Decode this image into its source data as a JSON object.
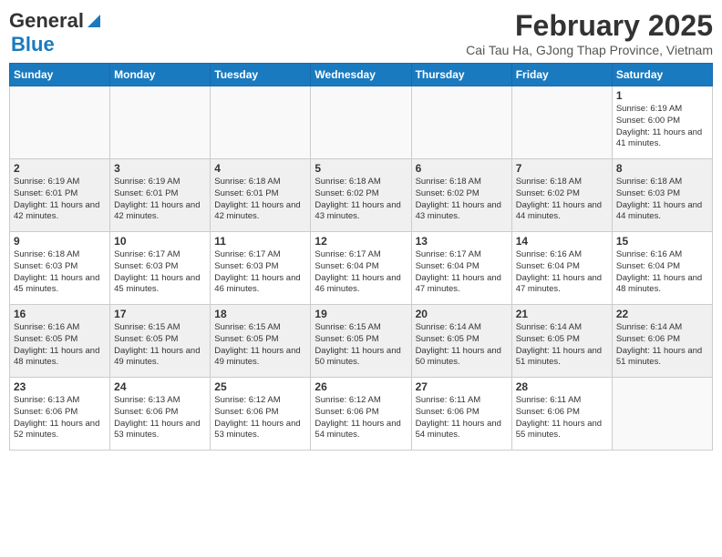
{
  "header": {
    "logo_general": "General",
    "logo_blue": "Blue",
    "month": "February 2025",
    "location": "Cai Tau Ha, GJong Thap Province, Vietnam"
  },
  "weekdays": [
    "Sunday",
    "Monday",
    "Tuesday",
    "Wednesday",
    "Thursday",
    "Friday",
    "Saturday"
  ],
  "weeks": [
    [
      {
        "day": "",
        "info": ""
      },
      {
        "day": "",
        "info": ""
      },
      {
        "day": "",
        "info": ""
      },
      {
        "day": "",
        "info": ""
      },
      {
        "day": "",
        "info": ""
      },
      {
        "day": "",
        "info": ""
      },
      {
        "day": "1",
        "info": "Sunrise: 6:19 AM\nSunset: 6:00 PM\nDaylight: 11 hours and 41 minutes."
      }
    ],
    [
      {
        "day": "2",
        "info": "Sunrise: 6:19 AM\nSunset: 6:01 PM\nDaylight: 11 hours and 42 minutes."
      },
      {
        "day": "3",
        "info": "Sunrise: 6:19 AM\nSunset: 6:01 PM\nDaylight: 11 hours and 42 minutes."
      },
      {
        "day": "4",
        "info": "Sunrise: 6:18 AM\nSunset: 6:01 PM\nDaylight: 11 hours and 42 minutes."
      },
      {
        "day": "5",
        "info": "Sunrise: 6:18 AM\nSunset: 6:02 PM\nDaylight: 11 hours and 43 minutes."
      },
      {
        "day": "6",
        "info": "Sunrise: 6:18 AM\nSunset: 6:02 PM\nDaylight: 11 hours and 43 minutes."
      },
      {
        "day": "7",
        "info": "Sunrise: 6:18 AM\nSunset: 6:02 PM\nDaylight: 11 hours and 44 minutes."
      },
      {
        "day": "8",
        "info": "Sunrise: 6:18 AM\nSunset: 6:03 PM\nDaylight: 11 hours and 44 minutes."
      }
    ],
    [
      {
        "day": "9",
        "info": "Sunrise: 6:18 AM\nSunset: 6:03 PM\nDaylight: 11 hours and 45 minutes."
      },
      {
        "day": "10",
        "info": "Sunrise: 6:17 AM\nSunset: 6:03 PM\nDaylight: 11 hours and 45 minutes."
      },
      {
        "day": "11",
        "info": "Sunrise: 6:17 AM\nSunset: 6:03 PM\nDaylight: 11 hours and 46 minutes."
      },
      {
        "day": "12",
        "info": "Sunrise: 6:17 AM\nSunset: 6:04 PM\nDaylight: 11 hours and 46 minutes."
      },
      {
        "day": "13",
        "info": "Sunrise: 6:17 AM\nSunset: 6:04 PM\nDaylight: 11 hours and 47 minutes."
      },
      {
        "day": "14",
        "info": "Sunrise: 6:16 AM\nSunset: 6:04 PM\nDaylight: 11 hours and 47 minutes."
      },
      {
        "day": "15",
        "info": "Sunrise: 6:16 AM\nSunset: 6:04 PM\nDaylight: 11 hours and 48 minutes."
      }
    ],
    [
      {
        "day": "16",
        "info": "Sunrise: 6:16 AM\nSunset: 6:05 PM\nDaylight: 11 hours and 48 minutes."
      },
      {
        "day": "17",
        "info": "Sunrise: 6:15 AM\nSunset: 6:05 PM\nDaylight: 11 hours and 49 minutes."
      },
      {
        "day": "18",
        "info": "Sunrise: 6:15 AM\nSunset: 6:05 PM\nDaylight: 11 hours and 49 minutes."
      },
      {
        "day": "19",
        "info": "Sunrise: 6:15 AM\nSunset: 6:05 PM\nDaylight: 11 hours and 50 minutes."
      },
      {
        "day": "20",
        "info": "Sunrise: 6:14 AM\nSunset: 6:05 PM\nDaylight: 11 hours and 50 minutes."
      },
      {
        "day": "21",
        "info": "Sunrise: 6:14 AM\nSunset: 6:05 PM\nDaylight: 11 hours and 51 minutes."
      },
      {
        "day": "22",
        "info": "Sunrise: 6:14 AM\nSunset: 6:06 PM\nDaylight: 11 hours and 51 minutes."
      }
    ],
    [
      {
        "day": "23",
        "info": "Sunrise: 6:13 AM\nSunset: 6:06 PM\nDaylight: 11 hours and 52 minutes."
      },
      {
        "day": "24",
        "info": "Sunrise: 6:13 AM\nSunset: 6:06 PM\nDaylight: 11 hours and 53 minutes."
      },
      {
        "day": "25",
        "info": "Sunrise: 6:12 AM\nSunset: 6:06 PM\nDaylight: 11 hours and 53 minutes."
      },
      {
        "day": "26",
        "info": "Sunrise: 6:12 AM\nSunset: 6:06 PM\nDaylight: 11 hours and 54 minutes."
      },
      {
        "day": "27",
        "info": "Sunrise: 6:11 AM\nSunset: 6:06 PM\nDaylight: 11 hours and 54 minutes."
      },
      {
        "day": "28",
        "info": "Sunrise: 6:11 AM\nSunset: 6:06 PM\nDaylight: 11 hours and 55 minutes."
      },
      {
        "day": "",
        "info": ""
      }
    ]
  ]
}
